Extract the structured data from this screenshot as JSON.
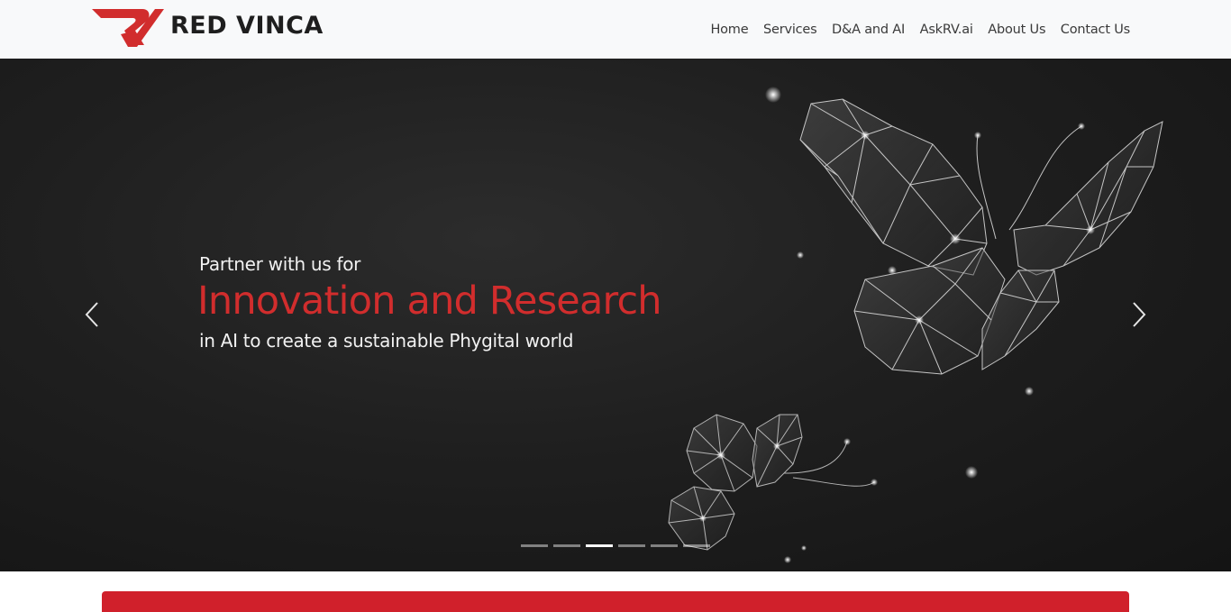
{
  "header": {
    "brand_name": "RED VINCA",
    "logo_icon": "red-vinca-rv-logo",
    "nav": [
      {
        "label": "Home"
      },
      {
        "label": "Services"
      },
      {
        "label": "D&A and AI"
      },
      {
        "label": "AskRV.ai"
      },
      {
        "label": "About Us"
      },
      {
        "label": "Contact Us"
      }
    ]
  },
  "hero": {
    "line1": "Partner with us for",
    "headline": "Innovation and Research",
    "line3": "in AI to create a sustainable Phygital world",
    "prev_icon": "chevron-left-icon",
    "next_icon": "chevron-right-icon",
    "slide_count": 6,
    "active_slide": 3,
    "art": "polygon-butterflies"
  },
  "colors": {
    "brand_red": "#d12d2d",
    "band_red": "#d0202b",
    "hero_bg": "#1f1f1f",
    "nav_bg": "#f8f9fa"
  }
}
